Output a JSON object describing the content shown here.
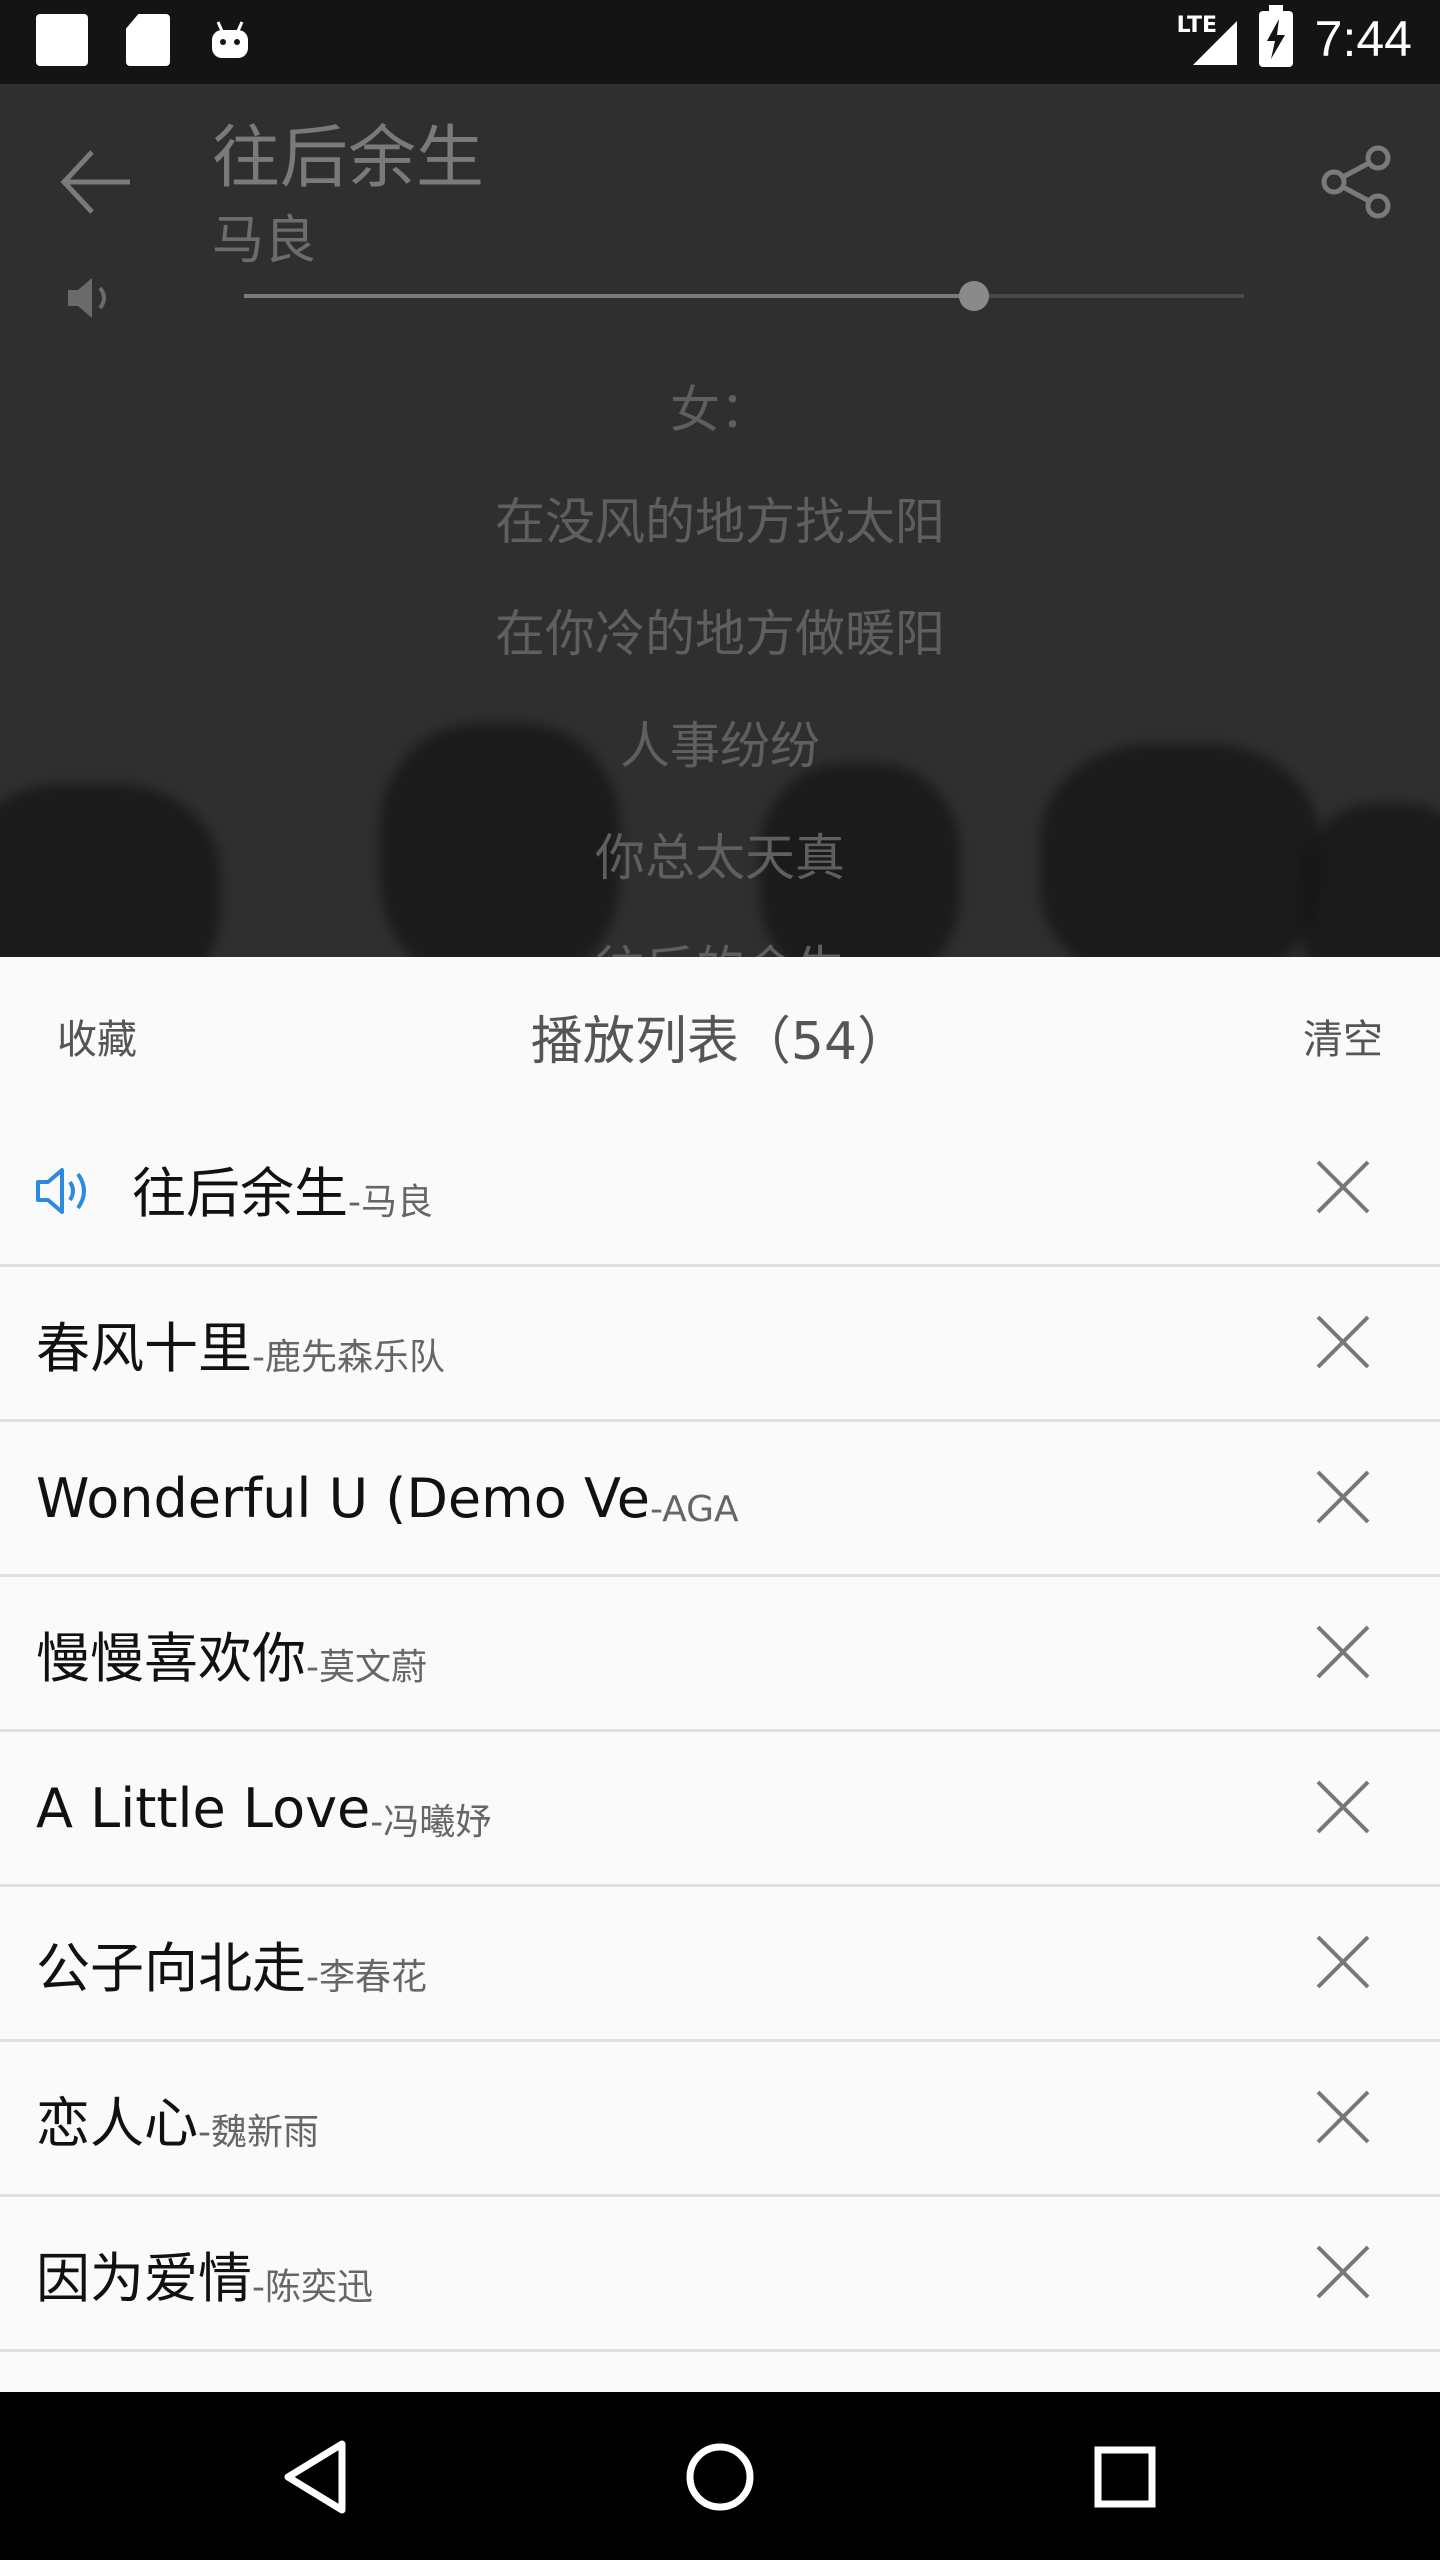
{
  "status_bar": {
    "network": "LTE",
    "time": "7:44",
    "icons": [
      "notification-square-icon",
      "sd-card-icon",
      "android-icon",
      "signal-icon",
      "battery-charging-icon"
    ]
  },
  "player": {
    "title": "往后余生",
    "artist": "马良",
    "volume_level": 0.73,
    "lyrics": [
      "女：",
      "在没风的地方找太阳",
      "在你冷的地方做暖阳",
      "人事纷纷",
      "你总太天真",
      "往后的余生"
    ]
  },
  "playlist": {
    "favorite_label": "收藏",
    "title": "播放列表（54）",
    "clear_label": "清空",
    "items": [
      {
        "name": "往后余生",
        "artist": "-马良",
        "playing": true
      },
      {
        "name": "春风十里",
        "artist": "-鹿先森乐队",
        "playing": false
      },
      {
        "name": "Wonderful U (Demo Ve",
        "artist": "-AGA",
        "playing": false
      },
      {
        "name": "慢慢喜欢你",
        "artist": "-莫文蔚",
        "playing": false
      },
      {
        "name": "A Little Love",
        "artist": "-冯曦妤",
        "playing": false
      },
      {
        "name": "公子向北走",
        "artist": "-李春花",
        "playing": false
      },
      {
        "name": "恋人心",
        "artist": "-魏新雨",
        "playing": false
      },
      {
        "name": "因为爱情",
        "artist": "-陈奕迅",
        "playing": false
      }
    ]
  },
  "colors": {
    "accent": "#2a8be0",
    "sheet_bg": "#fafafa",
    "player_bg": "#2f2f2f"
  },
  "nav_bar": {
    "icons": [
      "back-triangle-icon",
      "home-circle-icon",
      "recents-square-icon"
    ]
  }
}
